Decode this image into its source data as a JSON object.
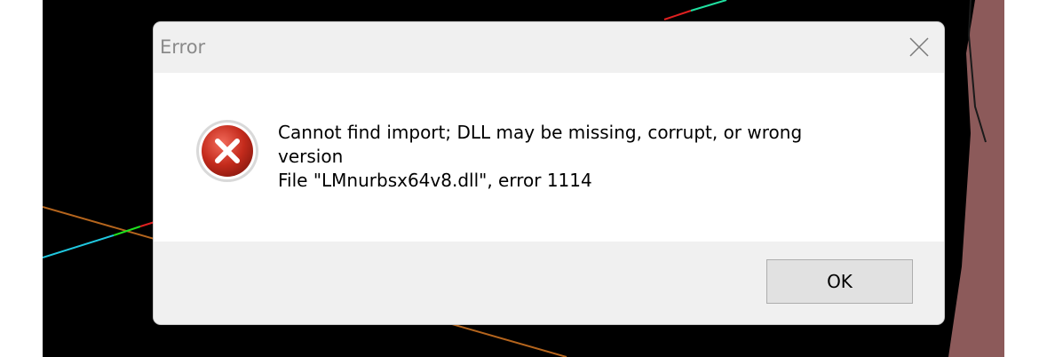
{
  "dialog": {
    "title": "Error",
    "close_icon": "close-icon",
    "icon": "error-icon",
    "message_lines": [
      "Cannot find import; DLL may be missing, corrupt, or wrong",
      "version",
      "File \"LMnurbsx64v8.dll\", error 1114"
    ],
    "ok_label": "OK"
  },
  "colors": {
    "viewport_background": "#000000",
    "titlebar": "#f0f0f0",
    "footer": "#f0f0f0",
    "error_red": "#c42b1c",
    "button_face": "#e1e1e1"
  }
}
